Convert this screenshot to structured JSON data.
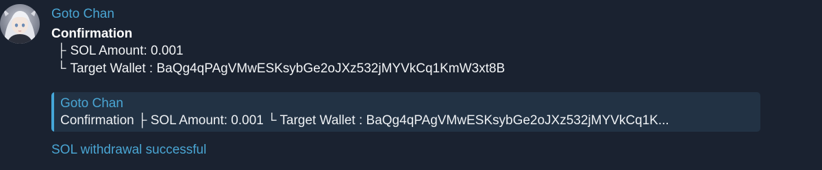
{
  "message": {
    "sender": "Goto Chan",
    "title": "Confirmation",
    "line1_glyph": "├",
    "line1_text": "SOL Amount: 0.001",
    "line2_glyph": "└",
    "line2_text": "Target Wallet : BaQg4qPAgVMwESKsybGe2oJXz532jMYVkCq1KmW3xt8B",
    "avatar_icon": "anime-girl-avatar"
  },
  "reply_quote": {
    "sender": "Goto Chan",
    "text": "Confirmation   ├ SOL Amount: 0.001   └ Target Wallet : BaQg4qPAgVMwESKsybGe2oJXz532jMYVkCq1K...",
    "accent_color": "#45a7d8"
  },
  "status": {
    "text": "SOL withdrawal successful"
  },
  "colors": {
    "background": "#1a2230",
    "sender_name": "#4aa6d4",
    "quote_background": "#223244"
  }
}
